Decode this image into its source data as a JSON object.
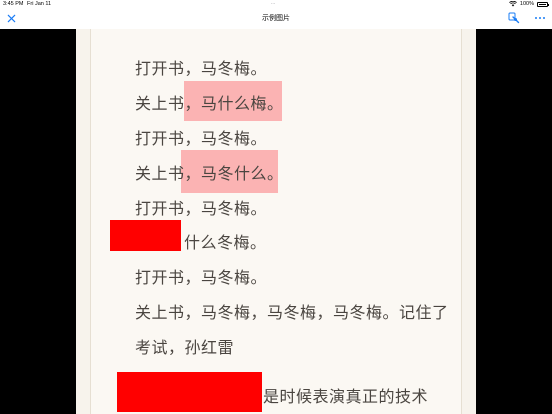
{
  "status_bar": {
    "time": "3:45 PM",
    "date": "Fri Jan 11",
    "dots": "...",
    "battery": "100%"
  },
  "navbar": {
    "title": "示例图片"
  },
  "document": {
    "lines": [
      "打开书，马冬梅。",
      "关上书，",
      "马什么梅。",
      "打开书，马冬梅。",
      "关上书，",
      "马冬什么。",
      "打开书，马冬梅。",
      "什么冬梅。",
      "打开书，马冬梅。",
      "关上书，马冬梅，马冬梅，马冬梅。记住了",
      "考试，孙红雷",
      "是时候表演真正的技术"
    ]
  },
  "colors": {
    "highlight": "#fbb3b3",
    "redaction": "#ff0000",
    "accent": "#1a7cf5"
  }
}
